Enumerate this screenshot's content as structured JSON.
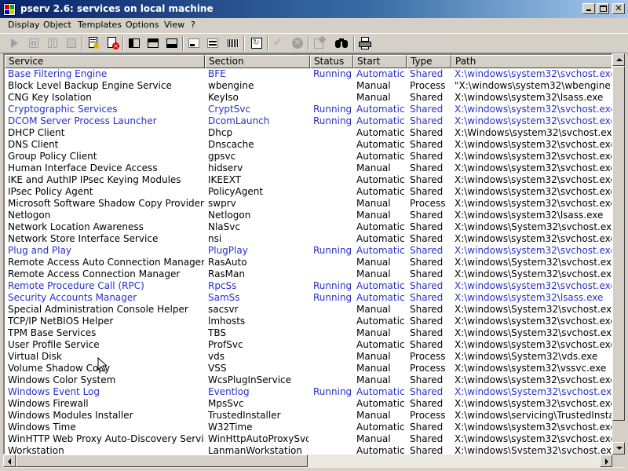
{
  "window": {
    "title": "pserv 2.6: services on local machine"
  },
  "menu": [
    "Display",
    "Object",
    "Templates",
    "Options",
    "View",
    "?"
  ],
  "toolbar_icons": [
    "start-icon",
    "pause-icon",
    "resume-icon",
    "stop-icon",
    "properties-icon",
    "delete-icon",
    "layout-left-icon",
    "layout-top-icon",
    "layout-bottom-icon",
    "small-view-icon",
    "details-view-icon",
    "barcode-icon",
    "refresh-icon",
    "check-icon",
    "cancel-icon",
    "edit-icon",
    "find-icon",
    "print-icon"
  ],
  "columns": [
    "Service",
    "Section",
    "Status",
    "Start",
    "Type",
    "Path"
  ],
  "rows": [
    {
      "service": "Base Filtering Engine",
      "section": "BFE",
      "status": "Running",
      "start": "Automatic",
      "type": "Shared",
      "path": "X:\\windows\\system32\\svchost.exe -"
    },
    {
      "service": "Block Level Backup Engine Service",
      "section": "wbengine",
      "status": "",
      "start": "Manual",
      "type": "Process",
      "path": "\"X:\\windows\\system32\\wbengine.ex"
    },
    {
      "service": "CNG Key Isolation",
      "section": "KeyIso",
      "status": "",
      "start": "Manual",
      "type": "Shared",
      "path": "X:\\windows\\system32\\lsass.exe"
    },
    {
      "service": "Cryptographic Services",
      "section": "CryptSvc",
      "status": "Running",
      "start": "Automatic",
      "type": "Shared",
      "path": "X:\\windows\\system32\\svchost.exe -"
    },
    {
      "service": "DCOM Server Process Launcher",
      "section": "DcomLaunch",
      "status": "Running",
      "start": "Automatic",
      "type": "Shared",
      "path": "X:\\windows\\system32\\svchost.exe -"
    },
    {
      "service": "DHCP Client",
      "section": "Dhcp",
      "status": "",
      "start": "Automatic",
      "type": "Shared",
      "path": "X:\\Windows\\system32\\svchost.exe"
    },
    {
      "service": "DNS Client",
      "section": "Dnscache",
      "status": "",
      "start": "Automatic",
      "type": "Shared",
      "path": "X:\\windows\\system32\\svchost.exe -"
    },
    {
      "service": "Group Policy Client",
      "section": "gpsvc",
      "status": "",
      "start": "Automatic",
      "type": "Shared",
      "path": "X:\\windows\\system32\\svchost.exe -"
    },
    {
      "service": "Human Interface Device Access",
      "section": "hidserv",
      "status": "",
      "start": "Manual",
      "type": "Shared",
      "path": "X:\\windows\\system32\\svchost.exe -"
    },
    {
      "service": "IKE and AuthIP IPsec Keying Modules",
      "section": "IKEEXT",
      "status": "",
      "start": "Automatic",
      "type": "Shared",
      "path": "X:\\windows\\system32\\svchost.exe -"
    },
    {
      "service": "IPsec Policy Agent",
      "section": "PolicyAgent",
      "status": "",
      "start": "Automatic",
      "type": "Shared",
      "path": "X:\\windows\\system32\\svchost.exe -"
    },
    {
      "service": "Microsoft Software Shadow Copy Provider",
      "section": "swprv",
      "status": "",
      "start": "Manual",
      "type": "Process",
      "path": "X:\\windows\\system32\\svchost.exe -"
    },
    {
      "service": "Netlogon",
      "section": "Netlogon",
      "status": "",
      "start": "Manual",
      "type": "Shared",
      "path": "X:\\windows\\system32\\lsass.exe"
    },
    {
      "service": "Network Location Awareness",
      "section": "NlaSvc",
      "status": "",
      "start": "Automatic",
      "type": "Shared",
      "path": "X:\\windows\\System32\\svchost.exe"
    },
    {
      "service": "Network Store Interface Service",
      "section": "nsi",
      "status": "",
      "start": "Automatic",
      "type": "Shared",
      "path": "X:\\windows\\system32\\svchost.exe -"
    },
    {
      "service": "Plug and Play",
      "section": "PlugPlay",
      "status": "Running",
      "start": "Automatic",
      "type": "Shared",
      "path": "X:\\windows\\system32\\svchost.exe -"
    },
    {
      "service": "Remote Access Auto Connection Manager",
      "section": "RasAuto",
      "status": "",
      "start": "Manual",
      "type": "Shared",
      "path": "X:\\windows\\System32\\svchost.exe"
    },
    {
      "service": "Remote Access Connection Manager",
      "section": "RasMan",
      "status": "",
      "start": "Manual",
      "type": "Shared",
      "path": "X:\\windows\\System32\\svchost.exe"
    },
    {
      "service": "Remote Procedure Call (RPC)",
      "section": "RpcSs",
      "status": "Running",
      "start": "Automatic",
      "type": "Shared",
      "path": "X:\\windows\\system32\\svchost.exe -"
    },
    {
      "service": "Security Accounts Manager",
      "section": "SamSs",
      "status": "Running",
      "start": "Automatic",
      "type": "Shared",
      "path": "X:\\windows\\system32\\lsass.exe"
    },
    {
      "service": "Special Administration Console Helper",
      "section": "sacsvr",
      "status": "",
      "start": "Manual",
      "type": "Shared",
      "path": "X:\\windows\\System32\\svchost.exe"
    },
    {
      "service": "TCP/IP NetBIOS Helper",
      "section": "lmhosts",
      "status": "",
      "start": "Automatic",
      "type": "Shared",
      "path": "X:\\windows\\system32\\svchost.exe"
    },
    {
      "service": "TPM Base Services",
      "section": "TBS",
      "status": "",
      "start": "Manual",
      "type": "Shared",
      "path": "X:\\windows\\System32\\svchost.exe"
    },
    {
      "service": "User Profile Service",
      "section": "ProfSvc",
      "status": "",
      "start": "Automatic",
      "type": "Shared",
      "path": "X:\\windows\\system32\\svchost.exe -"
    },
    {
      "service": "Virtual Disk",
      "section": "vds",
      "status": "",
      "start": "Manual",
      "type": "Process",
      "path": "X:\\windows\\System32\\vds.exe"
    },
    {
      "service": "Volume Shadow Copy",
      "section": "VSS",
      "status": "",
      "start": "Manual",
      "type": "Process",
      "path": "X:\\windows\\system32\\vssvc.exe"
    },
    {
      "service": "Windows Color System",
      "section": "WcsPlugInService",
      "status": "",
      "start": "Manual",
      "type": "Shared",
      "path": "X:\\windows\\system32\\svchost.exe -"
    },
    {
      "service": "Windows Event Log",
      "section": "Eventlog",
      "status": "Running",
      "start": "Automatic",
      "type": "Shared",
      "path": "X:\\windows\\System32\\svchost.exe"
    },
    {
      "service": "Windows Firewall",
      "section": "MpsSvc",
      "status": "",
      "start": "Automatic",
      "type": "Shared",
      "path": "X:\\windows\\system32\\svchost.exe -"
    },
    {
      "service": "Windows Modules Installer",
      "section": "TrustedInstaller",
      "status": "",
      "start": "Manual",
      "type": "Process",
      "path": "X:\\windows\\servicing\\TrustedInstalle"
    },
    {
      "service": "Windows Time",
      "section": "W32Time",
      "status": "",
      "start": "Automatic",
      "type": "Shared",
      "path": "X:\\windows\\system32\\svchost.exe -"
    },
    {
      "service": "WinHTTP Web Proxy Auto-Discovery Service",
      "section": "WinHttpAutoProxySvc",
      "status": "",
      "start": "Manual",
      "type": "Shared",
      "path": "X:\\windows\\system32\\svchost.exe -"
    },
    {
      "service": "Workstation",
      "section": "LanmanWorkstation",
      "status": "",
      "start": "Automatic",
      "type": "Shared",
      "path": "X:\\windows\\System32\\svchost.exe"
    }
  ]
}
